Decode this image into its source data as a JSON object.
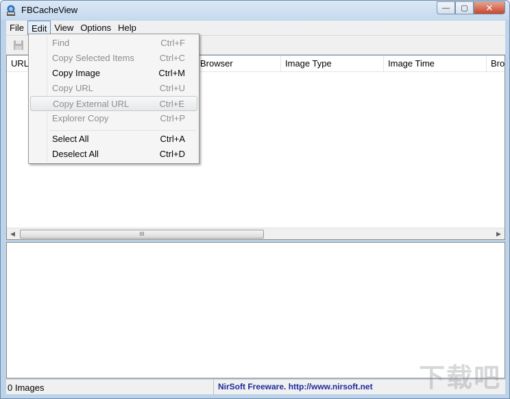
{
  "window": {
    "title": "FBCacheView",
    "controls": {
      "minimize": "—",
      "maximize": "▢",
      "close": "✕"
    }
  },
  "menubar": {
    "items": [
      {
        "label": "File"
      },
      {
        "label": "Edit"
      },
      {
        "label": "View"
      },
      {
        "label": "Options"
      },
      {
        "label": "Help"
      }
    ]
  },
  "toolbar": {
    "icons": [
      "save-icon"
    ]
  },
  "edit_menu": {
    "items": [
      {
        "label": "Find",
        "shortcut": "Ctrl+F",
        "enabled": false
      },
      {
        "label": "Copy Selected Items",
        "shortcut": "Ctrl+C",
        "enabled": false
      },
      {
        "label": "Copy Image",
        "shortcut": "Ctrl+M",
        "enabled": true
      },
      {
        "label": "Copy URL",
        "shortcut": "Ctrl+U",
        "enabled": false
      },
      {
        "label": "Copy External URL",
        "shortcut": "Ctrl+E",
        "enabled": false
      },
      {
        "label": "Explorer Copy",
        "shortcut": "Ctrl+P",
        "enabled": false
      },
      {
        "label": "Select All",
        "shortcut": "Ctrl+A",
        "enabled": true
      },
      {
        "label": "Deselect All",
        "shortcut": "Ctrl+D",
        "enabled": true
      }
    ]
  },
  "listview": {
    "columns": [
      {
        "label": "URL"
      },
      {
        "label": "Browser"
      },
      {
        "label": "Image Type"
      },
      {
        "label": "Image Time"
      },
      {
        "label": "Bro"
      }
    ],
    "scrollbar": {
      "left_arrow": "◀",
      "right_arrow": "▶",
      "thumb_grip": "III"
    }
  },
  "statusbar": {
    "count": "0 Images",
    "credit": "NirSoft Freeware.  http://www.nirsoft.net"
  },
  "watermark": "下载吧"
}
